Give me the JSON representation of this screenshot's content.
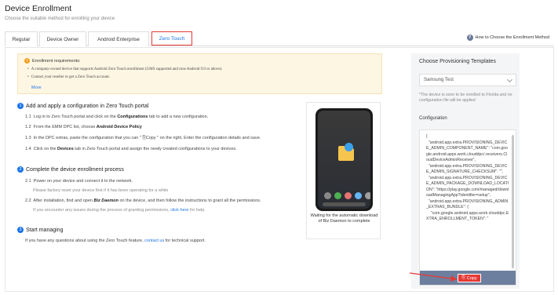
{
  "page": {
    "title": "Device Enrollment",
    "subtitle": "Choose the suitable method for enrolling your device"
  },
  "tabs": [
    {
      "label": "Regular"
    },
    {
      "label": "Device Owner"
    },
    {
      "label": "Android Enterprise"
    },
    {
      "label": "Zero Touch"
    }
  ],
  "help_link": "How to Choose the Enrollment Method",
  "notice": {
    "title": "Enrollment requirements:",
    "items": [
      "A company-owned device that supports Android Zero Touch enrollment (GMS supported and runs Android 9.0 or above).",
      "Contact your reseller to get a Zero Touch account."
    ],
    "more": "More"
  },
  "steps": {
    "s1": {
      "num": "1",
      "title": "Add and apply a configuration in Zero Touch portal",
      "a_num": "1.1",
      "a_pre": "Log in to Zero Touch portal and click on the ",
      "a_bold": "Configurations",
      "a_post": " tab to add a new configuration.",
      "b_num": "1.2",
      "b_pre": "From the EMM DPC list, choose ",
      "b_bold": "Android Device Policy",
      "b_post": "",
      "c_num": "1.3",
      "c_text": "In the DPC extras, paste the configuration that you can \" ⎘Copy \" on the right. Enter the configuration details and save.",
      "d_num": "1.4",
      "d_pre": "Click on the ",
      "d_bold": "Devices",
      "d_post": " tab in Zero Touch portal and assign the newly created configurations to your devices."
    },
    "s2": {
      "num": "2",
      "title": "Complete the device enrollment process",
      "a_num": "2.1",
      "a_text": "Power on your device and connect it to the network.",
      "a_note": "Please factory reset your device first if it has been operating for a while",
      "b_num": "2.2",
      "b_pre": "After installation, find and open ",
      "b_bold": "Biz Daemon",
      "b_post": " on the device, and then follow the instructions to grant all the permissions.",
      "b_note_pre": "If you encounter any issues during the process of granting permissions, ",
      "b_note_link": "click here",
      "b_note_post": " for help."
    },
    "s3": {
      "num": "3",
      "title": "Start managing",
      "text_pre": "If you have any questions about using the Zero Touch feature, ",
      "text_link": "contact us",
      "text_post": " for technical support."
    }
  },
  "phone_caption": "Waiting for the automatic download of Biz Daemon to complete",
  "side": {
    "title": "Choose Provisioning Templates",
    "select_value": "Samsung Test",
    "note": "*The device is soon to be enrolled to Florida and no configuration file will be applied",
    "config_label": "Configuration",
    "config_text": "{\n  \"android.app.extra.PROVISIONING_DEVICE_ADMIN_COMPONENT_NAME\": \"com.google.android.apps.work.clouddpc/.receivers.CloudDeviceAdminReceiver\",\n  \"android.app.extra.PROVISIONING_DEVICE_ADMIN_SIGNATURE_CHECKSUM\": \"\",\n  \"android.app.extra.PROVISIONING_DEVICE_ADMIN_PACKAGE_DOWNLOAD_LOCATION\": \"https://play.google.com/managed/downloadManagingApp?identifier=setup\",\n  \"android.app.extra.PROVISIONING_ADMIN_EXTRAS_BUNDLE\": {\n    \"com.google.android.apps.work.clouddpc.EXTRA_ENROLLMENT_TOKEN\": \"",
    "copy_label": "Copy"
  },
  "colors": {
    "accent": "#1a73e8",
    "highlight": "#e53935",
    "notice_bg": "#fdf6e3",
    "copy_bar": "#6d7f9e"
  }
}
